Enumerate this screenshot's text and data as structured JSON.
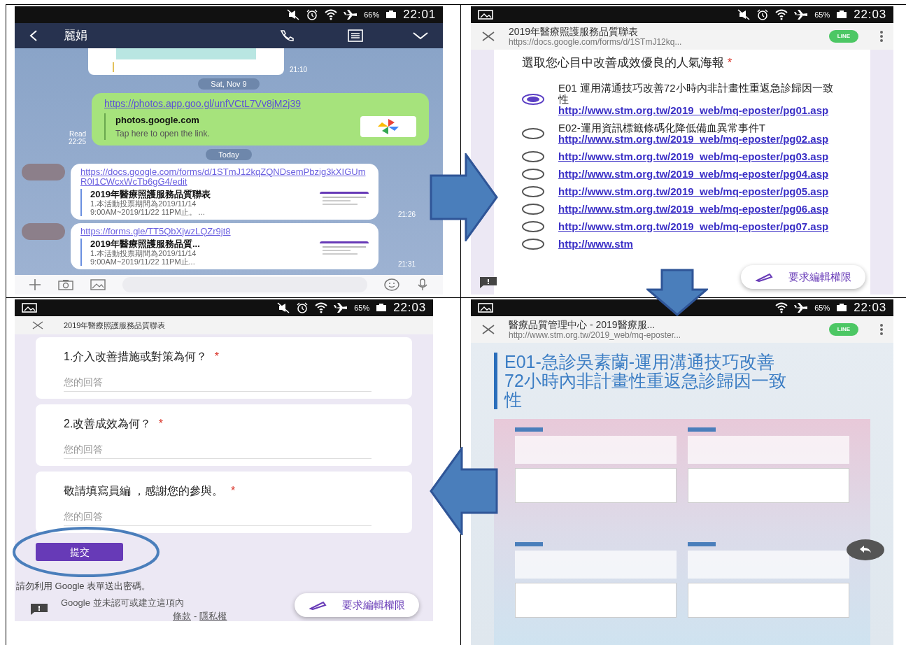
{
  "chat_screen": {
    "status_bar": {
      "battery": "66%",
      "time": "22:01"
    },
    "contact_name": "麗娟",
    "messages": [
      {
        "kind": "image",
        "time": "21:10"
      },
      {
        "kind": "date",
        "text": "Sat, Nov 9"
      },
      {
        "kind": "sent_link",
        "url": "https://photos.app.goo.gl/unfVCtL7Vv8jM2j39",
        "site": "photos.google.com",
        "hint": "Tap here to open the link.",
        "read": "Read",
        "time": "22:25"
      },
      {
        "kind": "date",
        "text": "Today"
      },
      {
        "kind": "received_link",
        "url": "https://docs.google.com/forms/d/1STmJ12kqZQNDsemPbzig3kXIGUmR0I1CWcxWcTb6gG4/edit",
        "title": "2019年醫療照護服務品質聯表",
        "description": "1.本活動投票期間為2019/11/14 9:00AM~2019/11/22 11PM止。 ...",
        "time": "21:26"
      },
      {
        "kind": "received_link",
        "url": "https://forms.gle/TT5QbXjwzLQZr9jt8",
        "title": "2019年醫療照護服務品質...",
        "description": "1.本活動投票期間為2019/11/14 9:00AM~2019/11/22 11PM止...",
        "time": "21:31"
      }
    ]
  },
  "form_choice_screen": {
    "status_bar": {
      "battery": "65%",
      "time": "22:03"
    },
    "browser": {
      "title": "2019年醫療照護服務品質聯表",
      "url": "https://docs.google.com/forms/d/1STmJ12kq...",
      "badge": "LINE"
    },
    "question": "選取您心目中改善成效優良的人氣海報",
    "required_mark": "*",
    "options": [
      {
        "label": "E01 運用溝通技巧改善72小時內非計畫性重返急診歸因一致性",
        "link": "http://www.stm.org.tw/2019_web/mq-eposter/pg01.asp",
        "selected": true
      },
      {
        "label": "E02-運用資訊標籤條碼化降低備血異常事件T",
        "link": "http://www.stm.org.tw/2019_web/mq-eposter/pg02.asp",
        "selected": false
      },
      {
        "link": "http://www.stm.org.tw/2019_web/mq-eposter/pg03.asp",
        "selected": false
      },
      {
        "link": "http://www.stm.org.tw/2019_web/mq-eposter/pg04.asp",
        "selected": false
      },
      {
        "link": "http://www.stm.org.tw/2019_web/mq-eposter/pg05.asp",
        "selected": false
      },
      {
        "link": "http://www.stm.org.tw/2019_web/mq-eposter/pg06.asp",
        "selected": false
      },
      {
        "link": "http://www.stm.org.tw/2019_web/mq-eposter/pg07.asp",
        "selected": false
      },
      {
        "link": "http://www.stm",
        "selected": false
      }
    ],
    "edit_request_button": "要求編輯權限"
  },
  "form_text_screen": {
    "status_bar": {
      "battery": "65%",
      "time": "22:03"
    },
    "header_title": "2019年醫療照護服務品質聯表",
    "questions": [
      {
        "title": "1.介入改善措施或對策為何？",
        "required_mark": "*",
        "placeholder": "您的回答"
      },
      {
        "title": "2.改善成效為何？",
        "required_mark": "*",
        "placeholder": "您的回答"
      },
      {
        "title": "敬請填寫員編 ，感謝您的參與。",
        "required_mark": "*",
        "placeholder": "您的回答"
      }
    ],
    "submit_button": "提交",
    "notice": "請勿利用 Google 表單送出密碼。",
    "footer": "Google 並未認可或建立這項內",
    "footer_links": [
      "條款",
      "隱私權"
    ],
    "footer_separator": "-",
    "edit_request_button": "要求編輯權限"
  },
  "poster_screen": {
    "status_bar": {
      "battery": "65%",
      "time": "22:03"
    },
    "browser": {
      "title": "醫療品質管理中心 - 2019醫療服...",
      "url": "http://www.stm.org.tw/2019_web/mq-eposter...",
      "badge": "LINE"
    },
    "heading": "E01-急診吳素蘭-運用溝通技巧改善72小時內非計畫性重返急診歸因一致性"
  }
}
